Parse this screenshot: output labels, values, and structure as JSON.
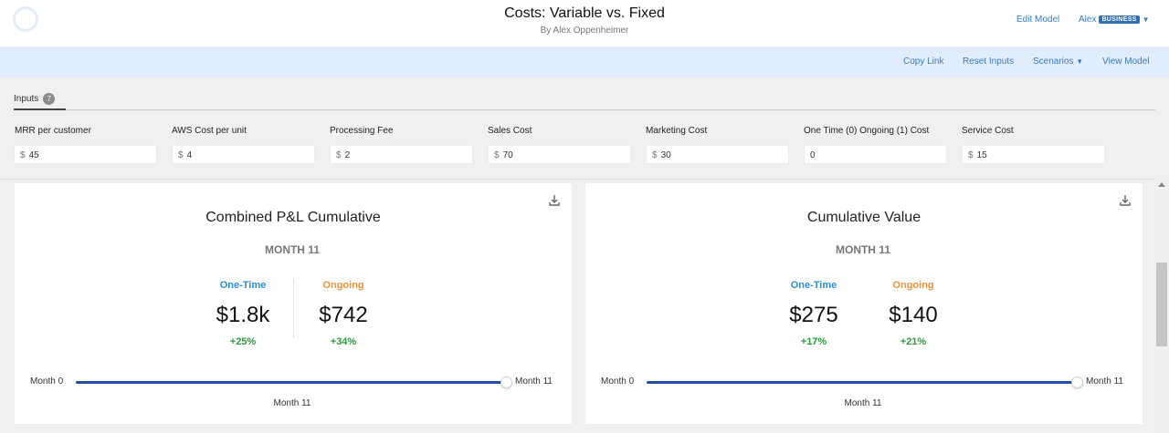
{
  "header": {
    "title": "Costs: Variable vs. Fixed",
    "subtitle": "By Alex Oppenheimer",
    "edit_model": "Edit Model",
    "user_name": "Alex",
    "user_badge": "BUSINESS",
    "caret": "▼"
  },
  "toolbar": {
    "copy_link": "Copy Link",
    "reset_inputs": "Reset Inputs",
    "scenarios": "Scenarios",
    "scenarios_caret": "▼",
    "view_model": "View Model"
  },
  "inputs": {
    "tab_label": "Inputs",
    "count": "7",
    "fields": [
      {
        "label": "MRR per customer",
        "prefix": "$",
        "value": "45"
      },
      {
        "label": "AWS Cost per unit",
        "prefix": "$",
        "value": "4"
      },
      {
        "label": "Processing Fee",
        "prefix": "$",
        "value": "2"
      },
      {
        "label": "Sales Cost",
        "prefix": "$",
        "value": "70"
      },
      {
        "label": "Marketing Cost",
        "prefix": "$",
        "value": "30"
      },
      {
        "label": "One Time (0) Ongoing (1) Cost",
        "prefix": "",
        "value": "0"
      },
      {
        "label": "Service Cost",
        "prefix": "$",
        "value": "15"
      }
    ]
  },
  "cards": [
    {
      "title": "Combined P&L Cumulative",
      "period": "MONTH 11",
      "one_time": {
        "label": "One-Time",
        "value": "$1.8k",
        "change": "+25%"
      },
      "ongoing": {
        "label": "Ongoing",
        "value": "$742",
        "change": "+34%"
      },
      "slider": {
        "min_label": "Month 0",
        "max_label": "Month 11",
        "caption": "Month 11",
        "position": 1.0
      }
    },
    {
      "title": "Cumulative Value",
      "period": "MONTH 11",
      "one_time": {
        "label": "One-Time",
        "value": "$275",
        "change": "+17%"
      },
      "ongoing": {
        "label": "Ongoing",
        "value": "$140",
        "change": "+21%"
      },
      "slider": {
        "min_label": "Month 0",
        "max_label": "Month 11",
        "caption": "Month 11",
        "position": 1.0
      }
    }
  ],
  "colors": {
    "accent": "#3b7bbf",
    "one_time": "#2b8fd6",
    "ongoing": "#f0923a",
    "positive": "#2b9a3a",
    "slider": "#1d4fa6",
    "toolbar_bg": "#e2edfb"
  }
}
